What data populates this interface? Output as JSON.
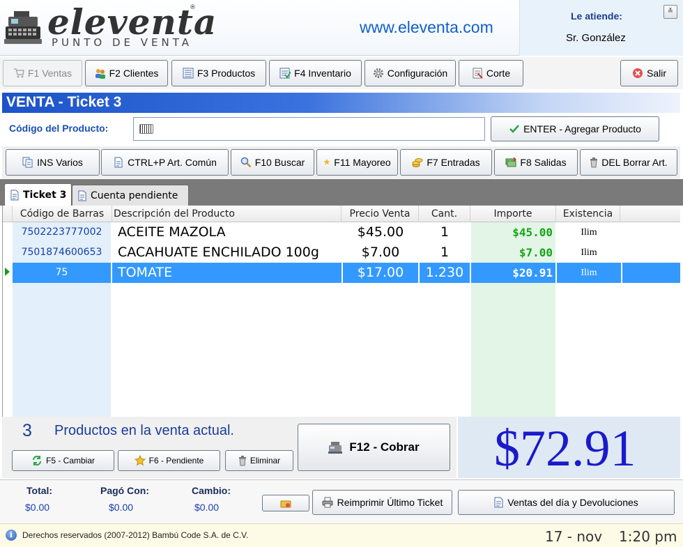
{
  "header": {
    "logo_text": "eleventa",
    "logo_reg": "®",
    "logo_subtitle": "PUNTO DE VENTA",
    "site_url": "www.eleventa.com",
    "attend_label": "Le atiende:",
    "attend_name": "Sr. González",
    "minimize_glyph": "≚"
  },
  "toolbar": {
    "sales": "F1 Ventas",
    "clients": "F2 Clientes",
    "products": "F3 Productos",
    "inventory": "F4 Inventario",
    "settings": "Configuración",
    "cut": "Corte",
    "exit": "Salir"
  },
  "sale": {
    "title": "VENTA - Ticket 3",
    "code_label": "Código del Producto:",
    "code_value": "",
    "add_button": "ENTER - Agregar Producto"
  },
  "actions": {
    "various": "INS Varios",
    "common_item": "CTRL+P Art. Común",
    "search": "F10 Buscar",
    "wholesale": "F11 Mayoreo",
    "entries": "F7 Entradas",
    "exits": "F8 Salidas",
    "delete_item": "DEL Borrar Art."
  },
  "tabs": [
    {
      "label": "Ticket 3",
      "active": true
    },
    {
      "label": "Cuenta pendiente",
      "active": false
    }
  ],
  "table": {
    "headers": [
      "Código de Barras",
      "Descripción del Producto",
      "Precio Venta",
      "Cant.",
      "Importe",
      "Existencia"
    ],
    "rows": [
      {
        "barcode": "7502223777002",
        "description": "ACEITE MAZOLA",
        "price": "$45.00",
        "qty": "1",
        "import": "$45.00",
        "stock": "Ilim"
      },
      {
        "barcode": "7501874600653",
        "description": "CACAHUATE ENCHILADO 100g",
        "price": "$7.00",
        "qty": "1",
        "import": "$7.00",
        "stock": "Ilim"
      },
      {
        "barcode": "75",
        "description": "TOMATE",
        "price": "$17.00",
        "qty": "1.230",
        "import": "$20.91",
        "stock": "Ilim"
      }
    ],
    "selected_row": 2
  },
  "summary": {
    "count": "3",
    "count_label": "Productos en la venta actual.",
    "change_button": "F5 - Cambiar",
    "pending_button": "F6 - Pendiente",
    "delete_button": "Eliminar",
    "charge_button": "F12 - Cobrar",
    "total_big": "$72.91"
  },
  "payment": {
    "total_label": "Total:",
    "total_value": "$0.00",
    "paid_label": "Pagó Con:",
    "paid_value": "$0.00",
    "change_label": "Cambio:",
    "change_value": "$0.00",
    "reprint_button": "Reimprimir Último Ticket",
    "daily_sales_button": "Ventas del día y Devoluciones"
  },
  "status": {
    "info_glyph": "i",
    "copyright": "Derechos reservados (2007-2012) Bambú Code S.A. de C.V.",
    "date": "17 - nov",
    "time": "1:20 pm"
  },
  "colors": {
    "title_bar": "#1c53c8",
    "selected_row": "#3399ff",
    "import_text": "#18a41a",
    "total_big": "#1a1acc"
  }
}
